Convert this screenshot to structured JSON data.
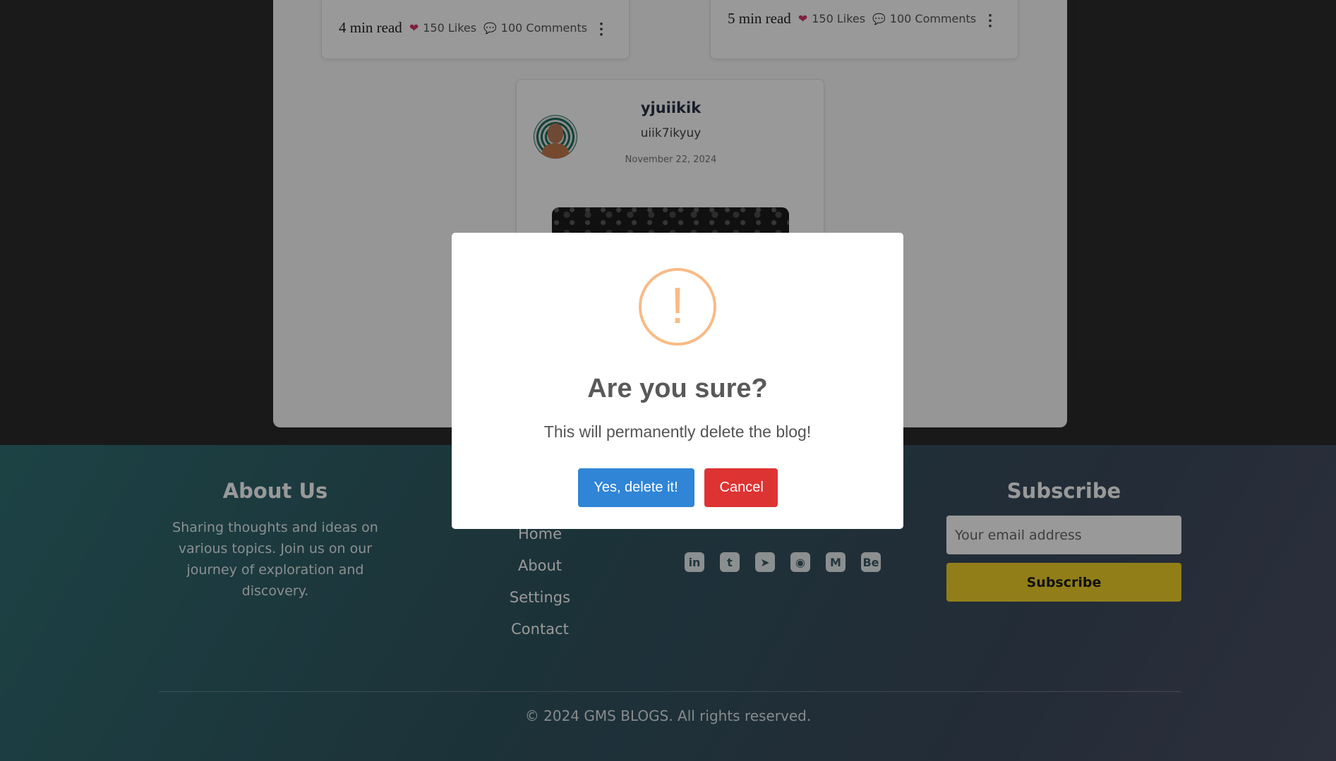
{
  "posts": [
    {
      "read_time": "4 min read",
      "likes": "150 Likes",
      "comments": "100 Comments"
    },
    {
      "read_time": "5 min read",
      "likes": "150 Likes",
      "comments": "100 Comments"
    }
  ],
  "featured_post": {
    "author": "yjuiikik",
    "handle": "uiik7ikyuy",
    "date": "November 22, 2024"
  },
  "footer": {
    "about": {
      "title": "About Us",
      "text": "Sharing thoughts and ideas on various topics. Join us on our journey of exploration and discovery."
    },
    "links": [
      "Home",
      "About",
      "Settings",
      "Contact"
    ],
    "social_icons": [
      {
        "name": "linkedin-icon",
        "glyph": "in"
      },
      {
        "name": "twitter-icon",
        "glyph": "t"
      },
      {
        "name": "telegram-icon",
        "glyph": "➤"
      },
      {
        "name": "github-icon",
        "glyph": "◉"
      },
      {
        "name": "medium-icon",
        "glyph": "M"
      },
      {
        "name": "behance-icon",
        "glyph": "Be"
      }
    ],
    "subscribe": {
      "title": "Subscribe",
      "placeholder": "Your email address",
      "button": "Subscribe"
    },
    "copyright": "© 2024 GMS BLOGS. All rights reserved."
  },
  "modal": {
    "icon_glyph": "!",
    "title": "Are you sure?",
    "text": "This will permanently delete the blog!",
    "confirm_label": "Yes, delete it!",
    "cancel_label": "Cancel"
  },
  "colors": {
    "confirm": "#3085d6",
    "cancel": "#dd3333",
    "warning": "#f8bb86",
    "subscribe_button": "#f2d22a"
  }
}
